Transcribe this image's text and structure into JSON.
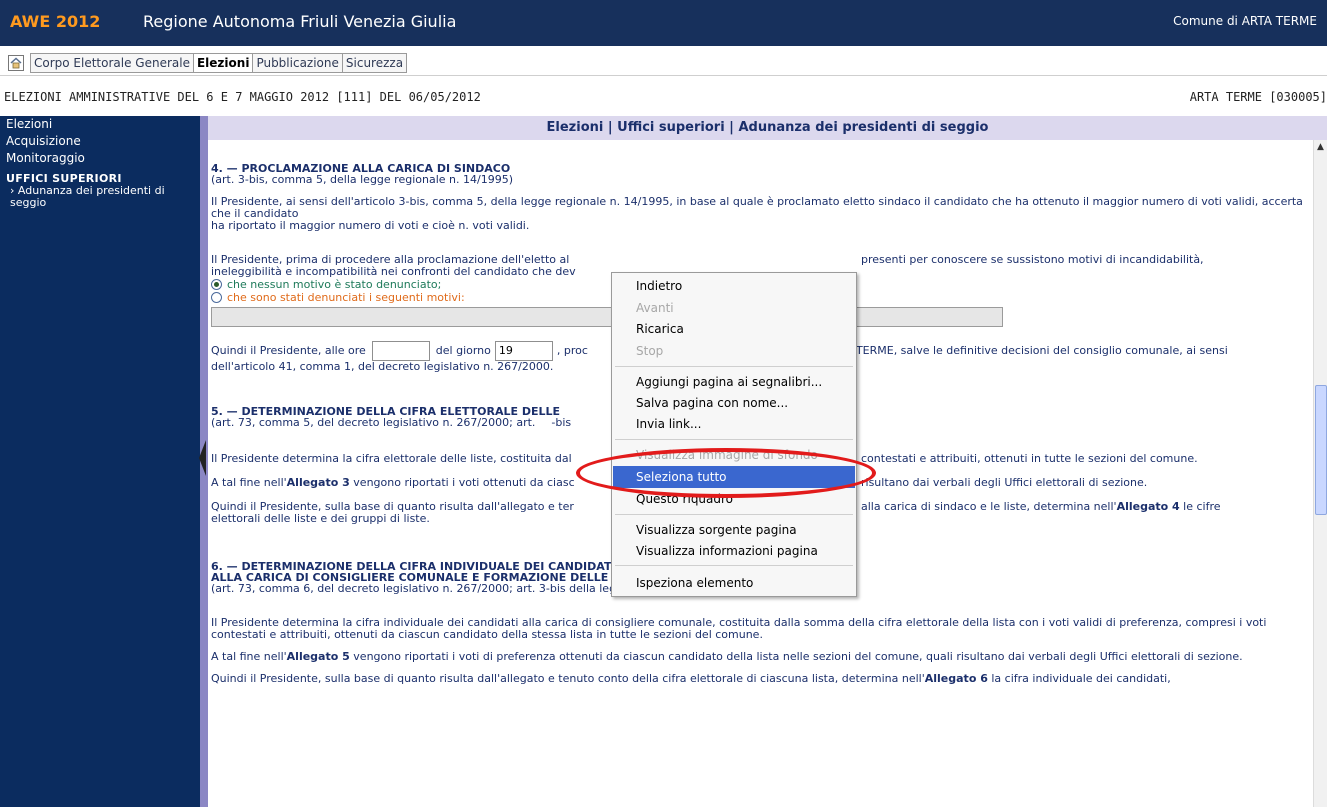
{
  "header": {
    "brand": "AWE 2012",
    "region": "Regione Autonoma Friuli Venezia Giulia",
    "comune": "Comune di ARTA TERME"
  },
  "menu": {
    "tabs": [
      "Corpo Elettorale Generale",
      "Elezioni",
      "Pubblicazione",
      "Sicurezza"
    ],
    "active": "Elezioni"
  },
  "infobar": {
    "left": "ELEZIONI AMMINISTRATIVE DEL 6 E 7 MAGGIO 2012 [111] DEL 06/05/2012",
    "right": "ARTA TERME [030005]"
  },
  "sidebar": {
    "items": [
      "Elezioni",
      "Acquisizione",
      "Monitoraggio"
    ],
    "section": "UFFICI SUPERIORI",
    "subitem": "Adunanza dei presidenti di seggio"
  },
  "content_title": "Elezioni | Uffici superiori | Adunanza dei presidenti di seggio",
  "sec4": {
    "title": "4. — PROCLAMAZIONE ALLA CARICA DI SINDACO",
    "sub": "(art. 3-bis, comma 5, della legge regionale n. 14/1995)",
    "p1a": "Il Presidente, ai sensi dell'articolo 3-bis, comma 5, della legge regionale n. 14/1995, in base al quale è proclamato eletto sindaco il candidato che ha ottenuto il maggior numero di voti validi, accerta che il candidato",
    "p1b": "ha riportato il maggior numero di voti e cioè n. voti validi.",
    "p2a": "Il Presidente, prima di procedere alla proclamazione dell'eletto al",
    "p2b": "ineleggibilità e incompatibilità nei confronti del candidato che dev",
    "p2c": "presenti per conoscere se sussistono motivi di incandidabilità,",
    "radio1": "che nessun motivo è stato denunciato;",
    "radio2": "che sono stati denunciati i seguenti motivi:",
    "p3a": "Quindi il Presidente, alle ore",
    "p3b": "del giorno",
    "giorno": "19",
    "p3c": ", proc",
    "p3d": "TERME, salve le definitive decisioni del consiglio comunale, ai sensi",
    "p3e": "dell'articolo 41, comma 1, del decreto legislativo n. 267/2000."
  },
  "sec5": {
    "title": "5. — DETERMINAZIONE DELLA CIFRA ELETTORALE DELLE",
    "sub_a": "(art. 73, comma 5, del decreto legislativo n. 267/2000; art.",
    "sub_b": "-bis",
    "p1a": "Il Presidente determina la cifra elettorale delle liste, costituita dal",
    "p1b": "contestati e attribuiti, ottenuti in tutte le sezioni del comune.",
    "p2a": "A tal fine nell'",
    "p2bold": "Allegato 3",
    "p2b": " vengono riportati i voti ottenuti da ciasc",
    "p2c": "risultano dai verbali degli Uffici elettorali di sezione.",
    "p3a": "Quindi il Presidente, sulla base di quanto risulta dall'allegato e ter",
    "p3b": "alla carica di sindaco e le liste, determina nell'",
    "p3bold": "Allegato 4",
    "p3c": " le cifre",
    "p3d": "elettorali delle liste e dei gruppi di liste."
  },
  "sec6": {
    "title1": "6. — DETERMINAZIONE DELLA CIFRA INDIVIDUALE DEI CANDIDATI",
    "title2": "ALLA CARICA DI CONSIGLIERE COMUNALE E FORMAZIONE DELLE RELATIVE GRADUATORIE",
    "sub": "(art. 73, comma 6, del decreto legislativo n. 267/2000; art. 3-bis della legge regionale n. 14/1995)",
    "p1": "Il Presidente determina la cifra individuale dei candidati alla carica di consigliere comunale, costituita dalla somma della cifra elettorale della lista con i voti validi di preferenza, compresi i voti contestati e attribuiti, ottenuti da ciascun candidato della stessa lista in tutte le sezioni del comune.",
    "p2a": "A tal fine nell'",
    "p2bold": "Allegato 5",
    "p2b": " vengono riportati i voti di preferenza ottenuti da ciascun candidato della lista nelle sezioni del comune, quali risultano dai verbali degli Uffici elettorali di sezione.",
    "p3a": "Quindi il Presidente, sulla base di quanto risulta dall'allegato e tenuto conto della cifra elettorale di ciascuna lista, determina nell'",
    "p3bold": "Allegato 6",
    "p3b": " la cifra individuale dei candidati,"
  },
  "context_menu": {
    "items": [
      {
        "label": "Indietro",
        "disabled": false
      },
      {
        "label": "Avanti",
        "disabled": true
      },
      {
        "label": "Ricarica",
        "disabled": false
      },
      {
        "label": "Stop",
        "disabled": true
      },
      {
        "label": "Aggiungi pagina ai segnalibri...",
        "disabled": false
      },
      {
        "label": "Salva pagina con nome...",
        "disabled": false
      },
      {
        "label": "Invia link...",
        "disabled": false
      },
      {
        "label": "Visualizza immagine di sfondo",
        "disabled": true
      },
      {
        "label": "Seleziona tutto",
        "disabled": false,
        "highlighted": true
      },
      {
        "label": "Questo riquadro",
        "disabled": false
      },
      {
        "label": "Visualizza sorgente pagina",
        "disabled": false
      },
      {
        "label": "Visualizza informazioni pagina",
        "disabled": false
      },
      {
        "label": "Ispeziona elemento",
        "disabled": false
      }
    ]
  },
  "colors": {
    "header_bg": "#17305c",
    "brand": "#ff9a1f",
    "sidebar_bg": "#0b2c5f",
    "menu_highlight": "#3a67cf",
    "annotation": "#e21b1b"
  }
}
